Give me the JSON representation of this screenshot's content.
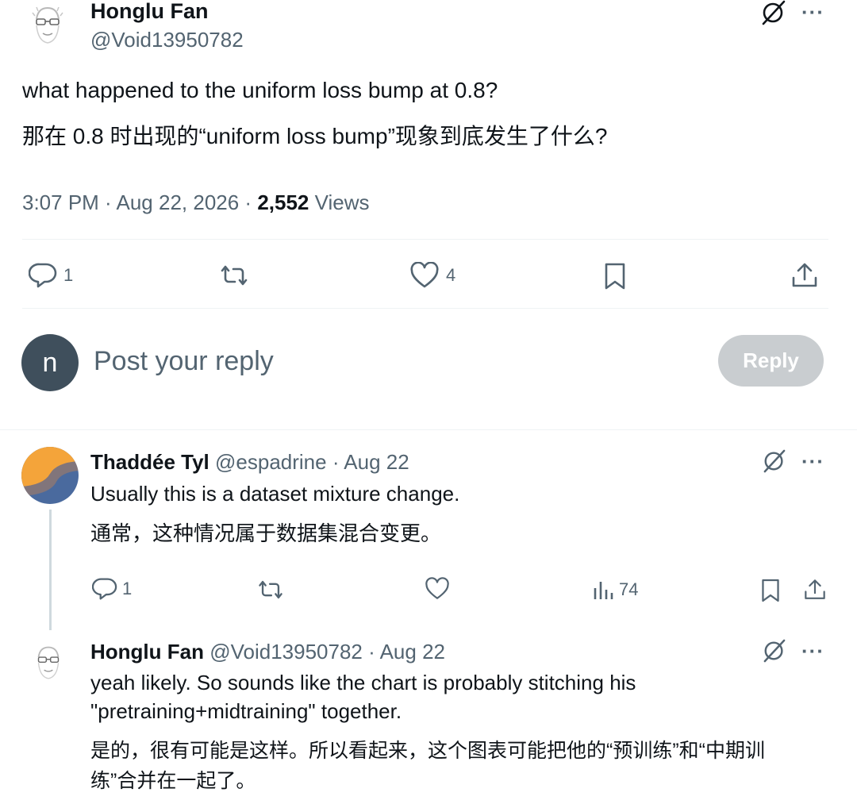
{
  "tweet": {
    "author_name": "Honglu Fan",
    "author_handle": "@Void13950782",
    "text_en": "what happened to the uniform loss bump at 0.8?",
    "text_zh": "那在 0.8 时出现的“uniform loss bump”现象到底发生了什么?",
    "time": "3:07 PM",
    "date": "Aug 22, 2026",
    "views_count": "2,552",
    "views_label": "Views",
    "replies": "1",
    "likes": "4"
  },
  "composer": {
    "avatar_letter": "n",
    "placeholder": "Post your reply",
    "reply_button": "Reply"
  },
  "replies": [
    {
      "name": "Thaddée Tyl",
      "handle": "@espadrine",
      "date": "Aug 22",
      "text_en": "Usually this is a dataset mixture change.",
      "text_zh": "通常，这种情况属于数据集混合变更。",
      "replies": "1",
      "views": "74"
    },
    {
      "name": "Honglu Fan",
      "handle": "@Void13950782",
      "date": "Aug 22",
      "text_en_1": "yeah likely. So sounds like the chart is probably stitching his",
      "text_en_2": "\"pretraining+midtraining\" together.",
      "text_zh_1": "是的，很有可能是这样。所以看起来，这个图表可能把他的“预训练”和“中期训",
      "text_zh_2": "练”合并在一起了。"
    }
  ],
  "ui": {
    "separator": " · ",
    "more_dots": "···",
    "accent": "#1d9bf0",
    "muted": "#536471",
    "icons": [
      "grok-icon",
      "more-icon",
      "reply-icon",
      "retweet-icon",
      "like-icon",
      "bookmark-icon",
      "share-icon",
      "views-icon"
    ]
  }
}
